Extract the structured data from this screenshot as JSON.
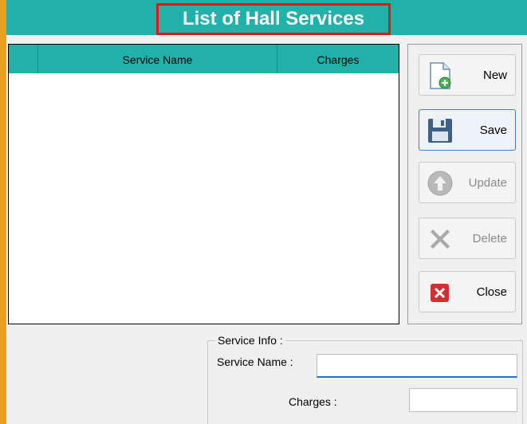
{
  "title": "List of Hall Services",
  "grid": {
    "columns": [
      "",
      "Service Name",
      "Charges"
    ],
    "rows": []
  },
  "buttons": {
    "new": "New",
    "save": "Save",
    "update": "Update",
    "delete": "Delete",
    "close": "Close"
  },
  "service_info": {
    "legend": "Service Info :",
    "service_name_label": "Service Name :",
    "service_name_value": "",
    "charges_label": "Charges :",
    "charges_value": ""
  },
  "icons": {
    "new": "new-document-icon",
    "save": "floppy-disk-icon",
    "update": "up-arrow-circle-icon",
    "delete": "x-cross-icon",
    "close": "close-red-x-icon"
  },
  "colors": {
    "header": "#20b2aa",
    "title_outline": "#e01818",
    "accent_border": "#e8a020",
    "focus": "#2a6fc9"
  }
}
